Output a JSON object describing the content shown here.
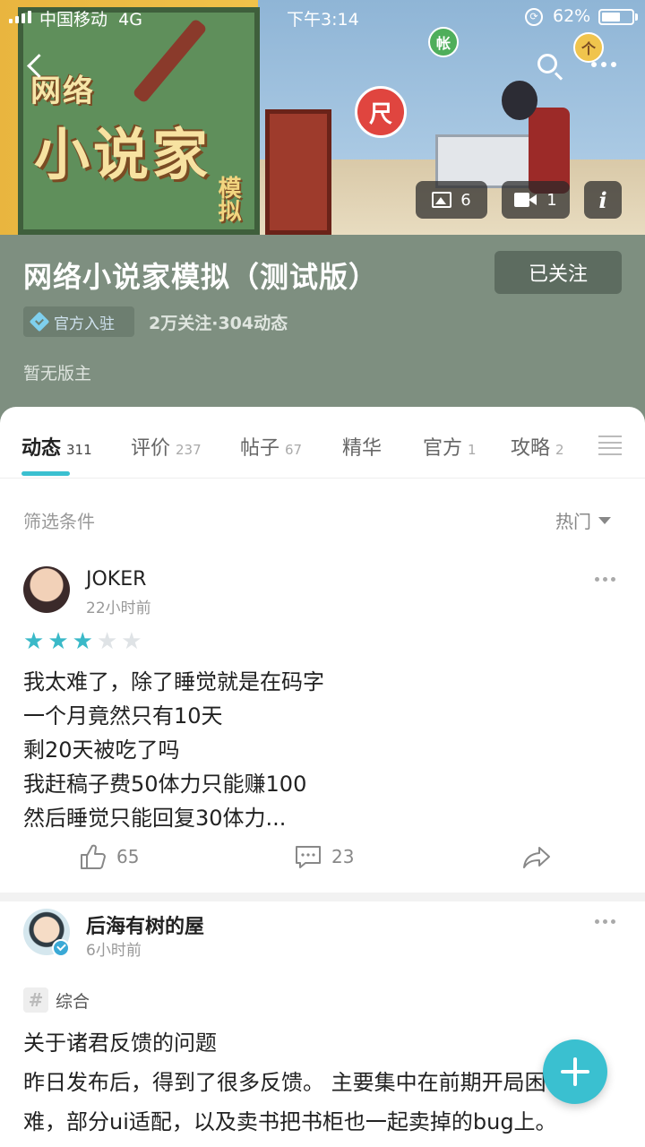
{
  "status_bar": {
    "carrier": "中国移动",
    "network": "4G",
    "time": "下午3:14",
    "battery": "62%",
    "battery_level": 0.62
  },
  "banner": {
    "art_title_top": "网络",
    "art_title_main": "小说家",
    "art_title_side": "模拟",
    "photo_count": "6",
    "video_count": "1",
    "info_label": "i",
    "art_badge_red": "尺",
    "art_badge_green": "帐",
    "art_badge_yellow": "个"
  },
  "header": {
    "title": "网络小说家模拟（测试版）",
    "follow_label": "已关注",
    "official_label": "官方入驻",
    "stats": "2万关注·304动态",
    "moderator": "暂无版主",
    "background_color": "#7e8f80"
  },
  "tabs": [
    {
      "label": "动态",
      "count": "311"
    },
    {
      "label": "评价",
      "count": "237"
    },
    {
      "label": "帖子",
      "count": "67"
    },
    {
      "label": "精华",
      "count": ""
    },
    {
      "label": "官方",
      "count": "1"
    },
    {
      "label": "攻略",
      "count": "2"
    }
  ],
  "filter": {
    "label": "筛选条件",
    "sort": "热门"
  },
  "posts": [
    {
      "author": "JOKER",
      "time": "22小时前",
      "rating": 3,
      "rating_max": 5,
      "lines": [
        "我太难了，除了睡觉就是在码字",
        "一个月竟然只有10天",
        "剩20天被吃了吗",
        "我赶稿子费50体力只能赚100",
        "然后睡觉只能回复30体力..."
      ],
      "likes": "65",
      "comments": "23"
    },
    {
      "author": "后海有树的屋",
      "time": "6小时前",
      "tag": "综合",
      "lines": [
        "关于诸君反馈的问题",
        "昨日发布后，得到了很多反馈。 主要集中在前期开局困",
        "难，部分ui适配，以及卖书把书柜也一起卖掉的bug上。"
      ]
    }
  ],
  "colors": {
    "accent": "#3ac0d0",
    "star_on": "#3ab9c8",
    "star_off": "#dfe3e6"
  }
}
